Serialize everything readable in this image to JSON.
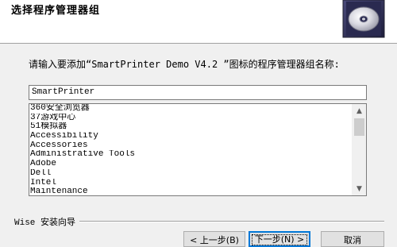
{
  "header": {
    "title": "选择程序管理器组",
    "icon": "cd-disc-icon"
  },
  "main": {
    "prompt": "请输入要添加“SmartPrinter Demo V4.2 ”图标的程序管理器组名称:",
    "group_name_value": "SmartPrinter",
    "group_list": [
      "360安全浏览器",
      "37游戏中心",
      "51模拟器",
      "Accessibility",
      "Accessories",
      "Administrative Tools",
      "Adobe",
      "Dell",
      "Intel",
      "Maintenance"
    ]
  },
  "footer": {
    "group_label": "Wise 安装向导",
    "back_label": "< 上一步(B)",
    "next_label": "下一步(N) >",
    "cancel_label": "取消"
  },
  "colors": {
    "header_bg": "#ffffff",
    "dialog_bg": "#f0f0f0",
    "focus_border": "#0078d7"
  }
}
